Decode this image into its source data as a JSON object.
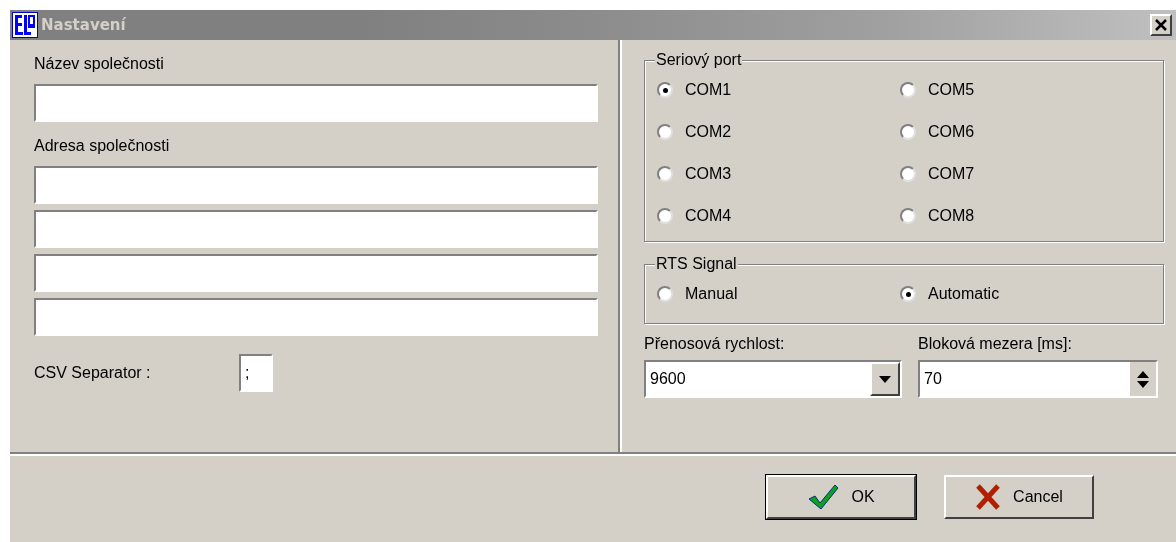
{
  "window": {
    "title": "Nastavení"
  },
  "company": {
    "name_label": "Název společnosti",
    "address_label": "Adresa společnosti"
  },
  "csv": {
    "label": "CSV Separator :",
    "value": ";"
  },
  "serial_port": {
    "title": "Seriový port",
    "options": [
      {
        "label": "COM1",
        "selected": true
      },
      {
        "label": "COM2",
        "selected": false
      },
      {
        "label": "COM3",
        "selected": false
      },
      {
        "label": "COM4",
        "selected": false
      },
      {
        "label": "COM5",
        "selected": false
      },
      {
        "label": "COM6",
        "selected": false
      },
      {
        "label": "COM7",
        "selected": false
      },
      {
        "label": "COM8",
        "selected": false
      }
    ]
  },
  "rts_signal": {
    "title": "RTS Signal",
    "options": [
      {
        "label": "Manual",
        "selected": false
      },
      {
        "label": "Automatic",
        "selected": true
      }
    ]
  },
  "baud_rate": {
    "label": "Přenosová rychlost:",
    "value": "9600"
  },
  "block_gap": {
    "label": "Bloková mezera [ms]:",
    "value": "70"
  },
  "buttons": [
    {
      "kind": "ok",
      "label": "OK"
    },
    {
      "kind": "cancel",
      "label": "Cancel"
    }
  ]
}
